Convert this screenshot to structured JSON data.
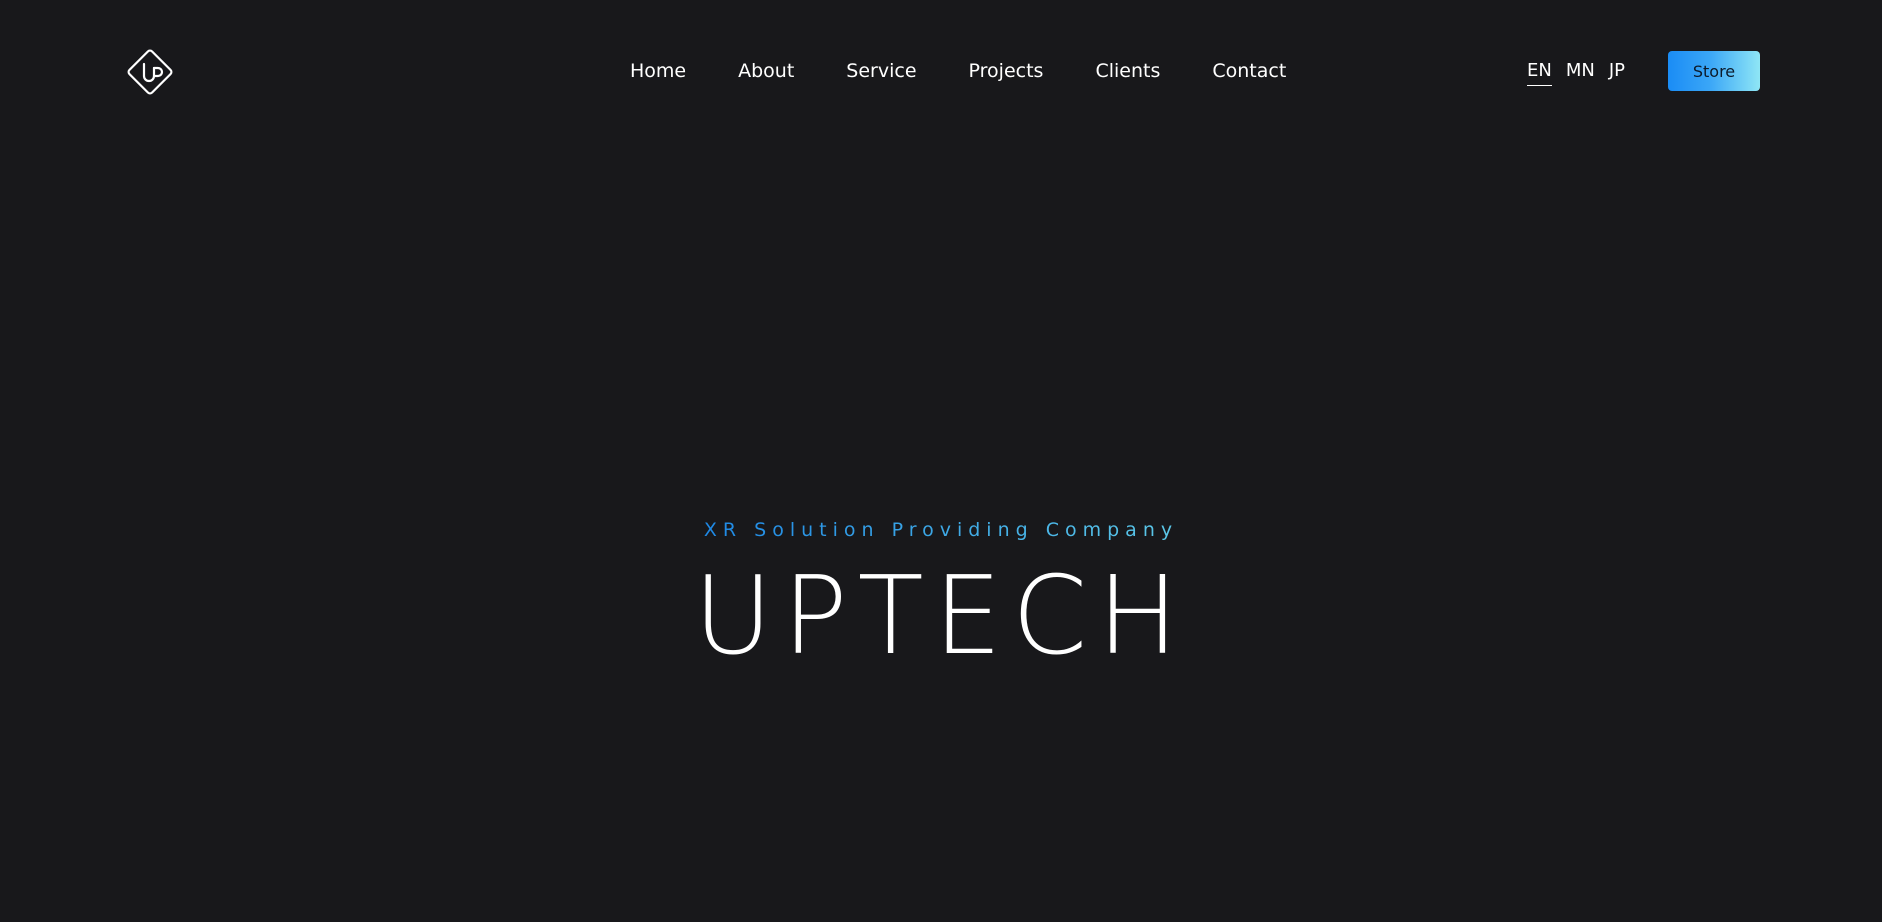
{
  "header": {
    "logo_icon": "up-diamond-logo-icon",
    "nav": [
      {
        "label": "Home"
      },
      {
        "label": "About"
      },
      {
        "label": "Service"
      },
      {
        "label": "Projects"
      },
      {
        "label": "Clients"
      },
      {
        "label": "Contact"
      }
    ],
    "languages": [
      {
        "label": "EN",
        "active": true
      },
      {
        "label": "MN",
        "active": false
      },
      {
        "label": "JP",
        "active": false
      }
    ],
    "store_label": "Store"
  },
  "hero": {
    "subtitle": "XR Solution Providing Company",
    "title": "UPTECH"
  },
  "colors": {
    "background": "#18181b",
    "accent_start": "#1a8cf5",
    "accent_end": "#8fe6f5",
    "text": "#ffffff"
  }
}
